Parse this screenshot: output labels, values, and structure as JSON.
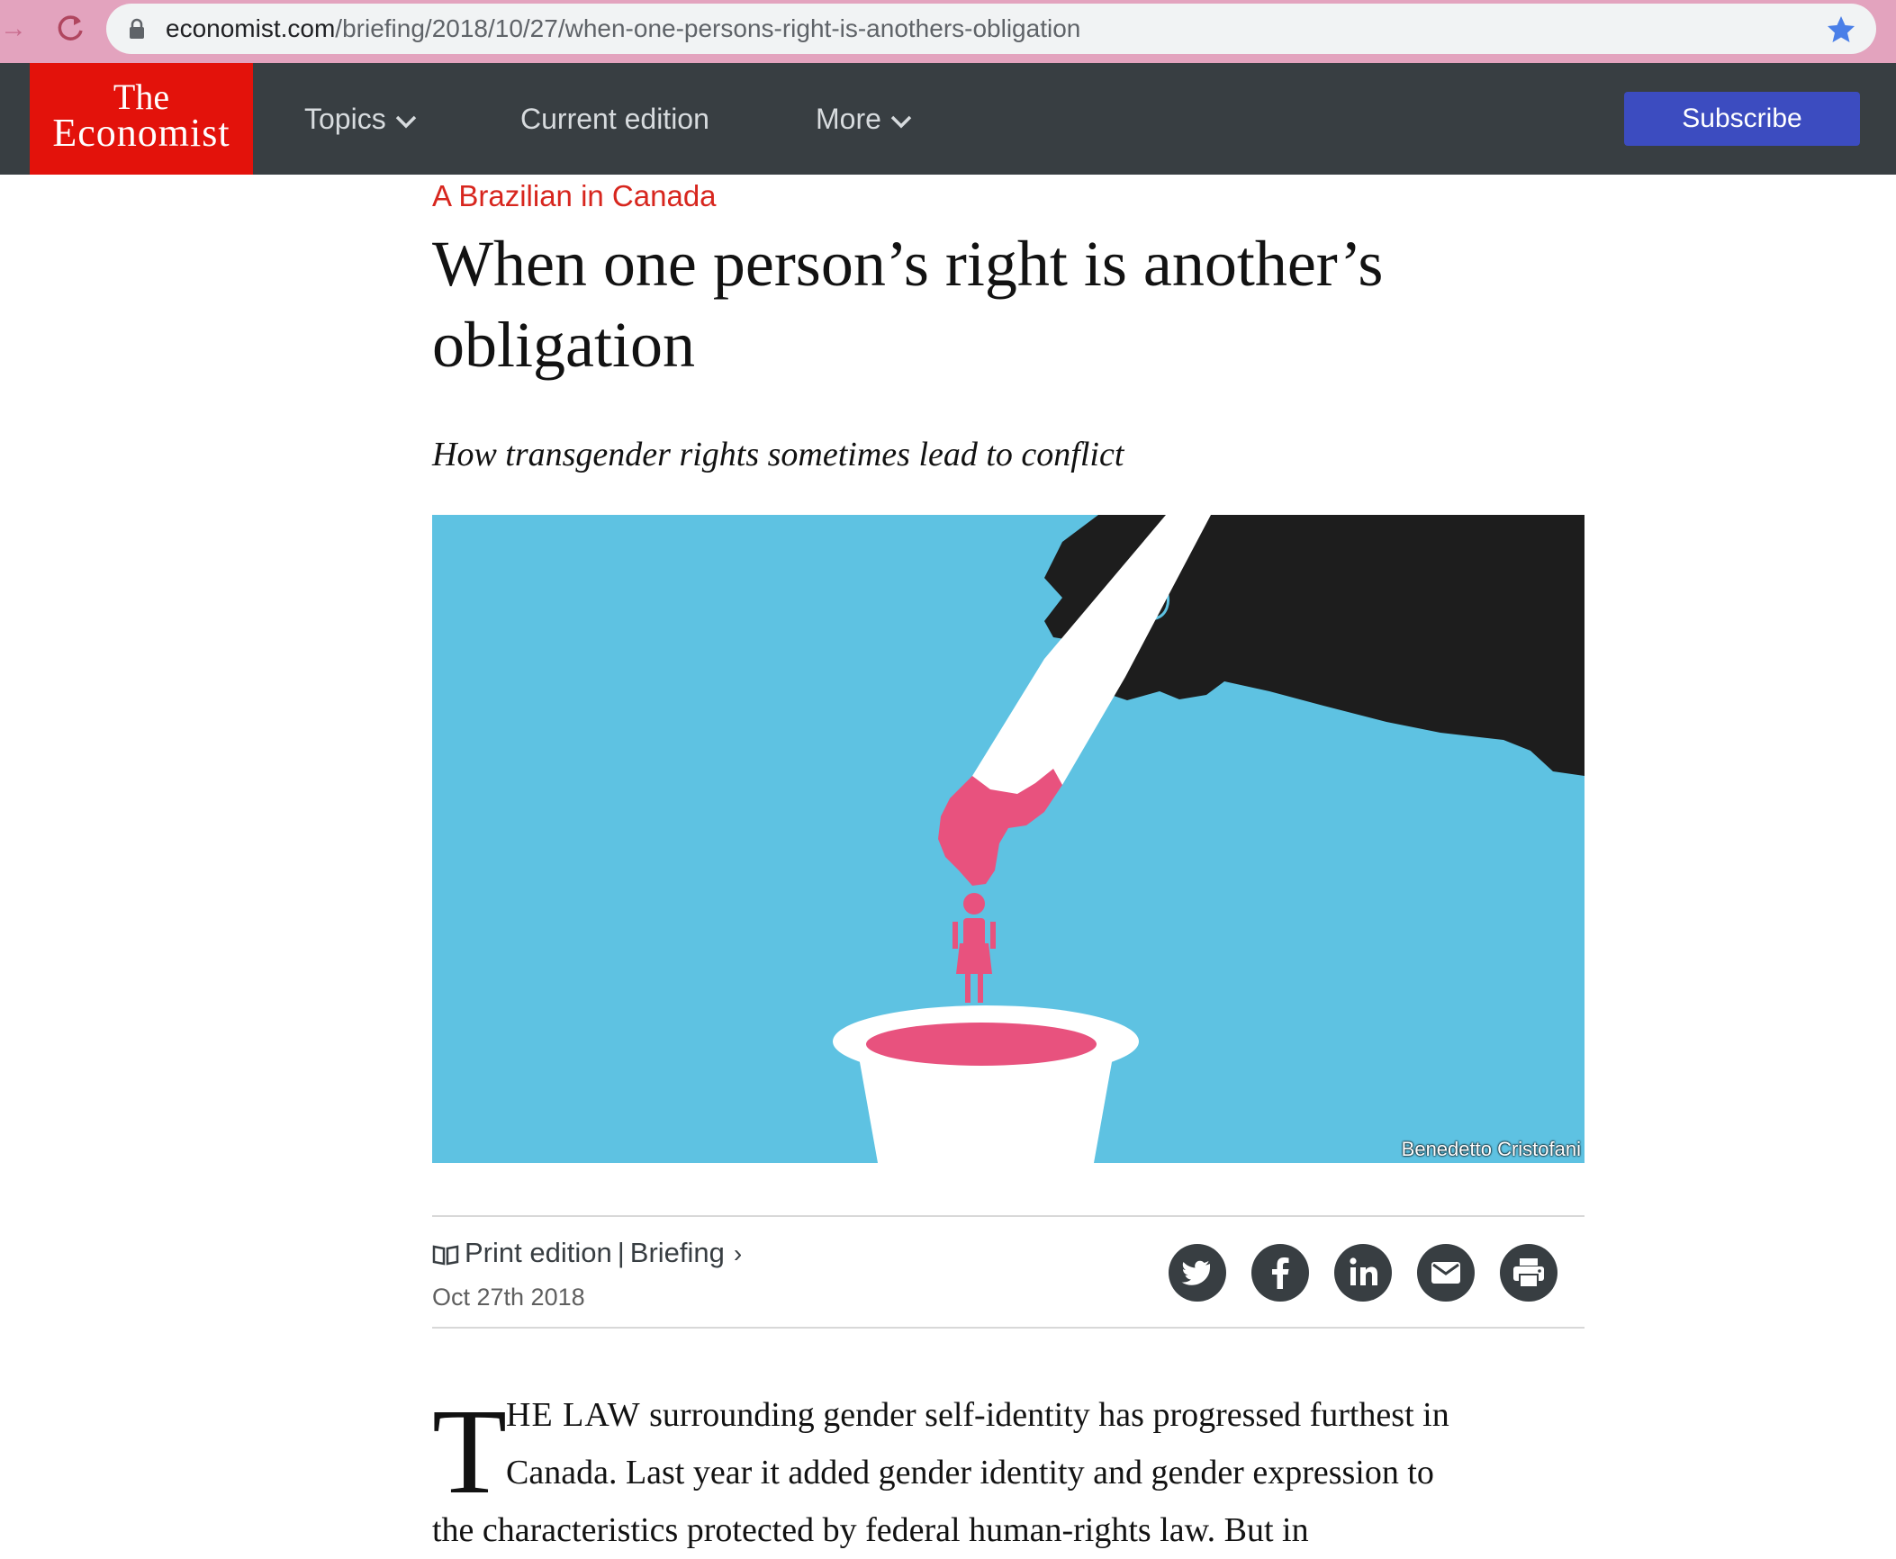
{
  "browser": {
    "url_domain": "economist.com",
    "url_path": "/briefing/2018/10/27/when-one-persons-right-is-anothers-obligation"
  },
  "nav": {
    "logo_line1": "The",
    "logo_line2": "Economist",
    "topics": "Topics",
    "current_edition": "Current edition",
    "more": "More",
    "subscribe": "Subscribe"
  },
  "article": {
    "rubric": "A Brazilian in Canada",
    "headline_line1": "When one person’s right is another’s",
    "headline_line2": "obligation",
    "subheadline": "How transgender rights sometimes lead to conflict",
    "image_credit": "Benedetto Cristofani",
    "print_edition": "Print edition",
    "section": "Briefing",
    "date": "Oct 27th 2018",
    "dropcap": "T",
    "body_line1_smallcaps": "HE LAW",
    "body_line1_rest": " surrounding gender self-identity has progressed furthest in",
    "body_line2": "Canada. Last year it added gender identity and gender expression to",
    "body_line3": "the characteristics protected by federal human-rights law. But in"
  },
  "share": [
    "twitter-icon",
    "facebook-icon",
    "linkedin-icon",
    "email-icon",
    "print-icon"
  ],
  "colors": {
    "nav_bg": "#383e42",
    "logo_red": "#e3120b",
    "rubric_red": "#d7261e",
    "subscribe_blue": "#3c4cc0",
    "hero_bg": "#5ec2e2",
    "pink": "#e8527e"
  }
}
